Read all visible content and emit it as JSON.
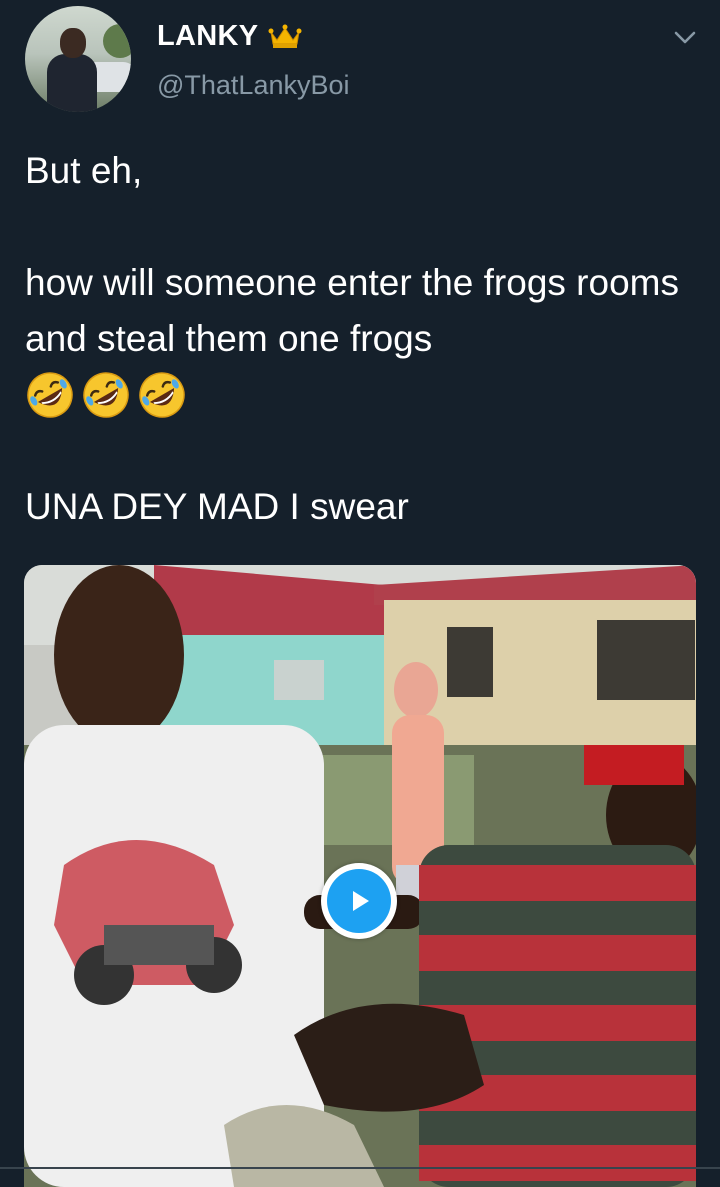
{
  "author": {
    "display_name": "LANKY",
    "handle": "@ThatLankyBoi",
    "badge_icon": "crown-icon"
  },
  "tweet": {
    "line1": "But eh,",
    "line2": "how will someone enter the frogs rooms and steal them one frogs",
    "emojis": [
      "rolling-on-floor-laughing-emoji",
      "rolling-on-floor-laughing-emoji",
      "rolling-on-floor-laughing-emoji"
    ],
    "line3": "UNA DEY MAD I swear"
  },
  "media": {
    "type": "video",
    "play_icon": "play-icon"
  },
  "colors": {
    "background": "#15202b",
    "text": "#ffffff",
    "secondary_text": "#8899a6",
    "accent": "#1da1f2"
  }
}
